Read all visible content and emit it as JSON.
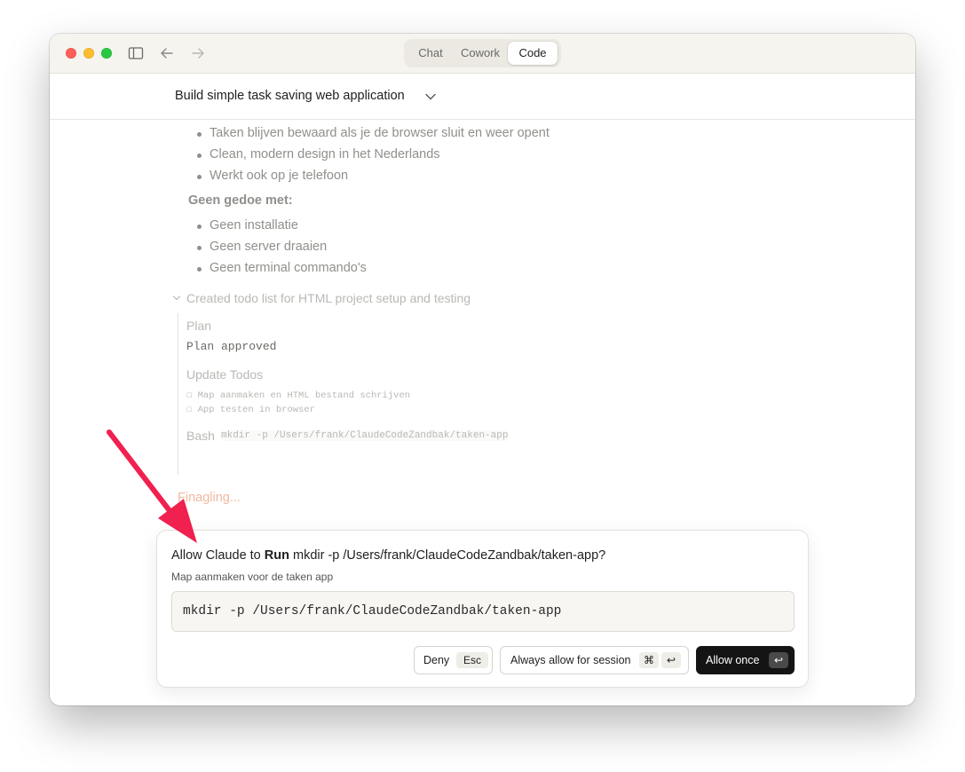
{
  "window": {
    "tabs": [
      {
        "label": "Chat",
        "active": false
      },
      {
        "label": "Cowork",
        "active": false
      },
      {
        "label": "Code",
        "active": true
      }
    ],
    "icons": [
      "sidebar-toggle-icon",
      "arrow-left-icon",
      "arrow-right-icon"
    ]
  },
  "header": {
    "title": "Build simple task saving web application"
  },
  "transcript": {
    "bullets_1": [
      "Taken blijven bewaard als je de browser sluit en weer opent",
      "Clean, modern design in het Nederlands",
      "Werkt ook op je telefoon"
    ],
    "subheading": "Geen gedoe met:",
    "bullets_2": [
      "Geen installatie",
      "Geen server draaien",
      "Geen terminal commando's"
    ],
    "tool_group_title": "Created todo list for HTML project setup and testing",
    "plan_label": "Plan",
    "plan_status": "Plan approved",
    "update_todos_label": "Update Todos",
    "todos": [
      "Map aanmaken en HTML bestand schrijven",
      "App testen in browser"
    ],
    "bash_label": "Bash",
    "bash_command": "mkdir -p /Users/frank/ClaudeCodeZandbak/taken-app",
    "status_text": "Finagling..."
  },
  "permission": {
    "question_prefix": "Allow Claude to ",
    "question_action": "Run",
    "question_command": " mkdir -p /Users/frank/ClaudeCodeZandbak/taken-app?",
    "description": "Map aanmaken voor de taken app",
    "command": "mkdir -p /Users/frank/ClaudeCodeZandbak/taken-app",
    "deny_label": "Deny",
    "deny_shortcut": "Esc",
    "always_label": "Always allow for session",
    "always_shortcut_cmd": "⌘",
    "always_shortcut_enter": "↩",
    "allow_label": "Allow once",
    "allow_shortcut": "↩"
  },
  "colors": {
    "accent": "#141414",
    "annotation_arrow": "#f0204f",
    "status": "#f0b8a0"
  }
}
